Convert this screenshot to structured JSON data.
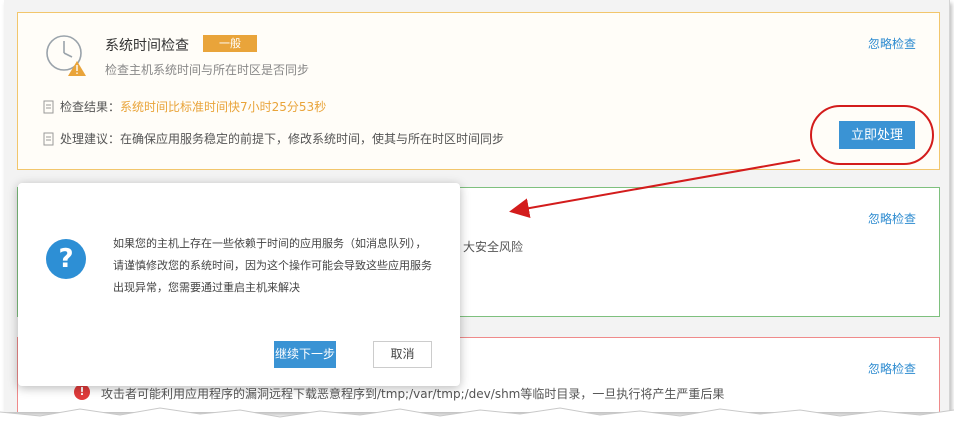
{
  "check_card": {
    "title": "系统时间检查",
    "level": "一般",
    "description": "检查主机系统时间与所在时区是否同步",
    "ignore_label": "忽略检查",
    "result_label": "检查结果：",
    "result_value": "系统时间比标准时间快7小时25分53秒",
    "suggest_label": "处理建议：",
    "suggest_value": "在确保应用服务稳定的前提下，修改系统时间，使其与所在时区时间同步",
    "handle_label": "立即处理",
    "level_color": "#e9a43a"
  },
  "card_ok": {
    "ignore_label": "忽略检查",
    "text_fragment": "大安全风险"
  },
  "card_risk": {
    "ignore_label": "忽略检查",
    "text": "攻击者可能利用应用程序的漏洞远程下载恶意程序到/tmp;/var/tmp;/dev/shm等临时目录，一旦执行将产生严重后果"
  },
  "dialog": {
    "line1": "如果您的主机上存在一些依赖于时间的应用服务（如消息队列），",
    "line2": "请谨慎修改您的系统时间，因为这个操作可能会导致这些应用服务",
    "line3": "出现异常，您需要通过重启主机来解决",
    "continue_label": "继续下一步",
    "cancel_label": "取消",
    "icon": "question-icon"
  },
  "colors": {
    "accent": "#3a93d4",
    "warning": "#e9a43a",
    "danger": "#e03b3b",
    "annotation": "#d31c1c"
  }
}
